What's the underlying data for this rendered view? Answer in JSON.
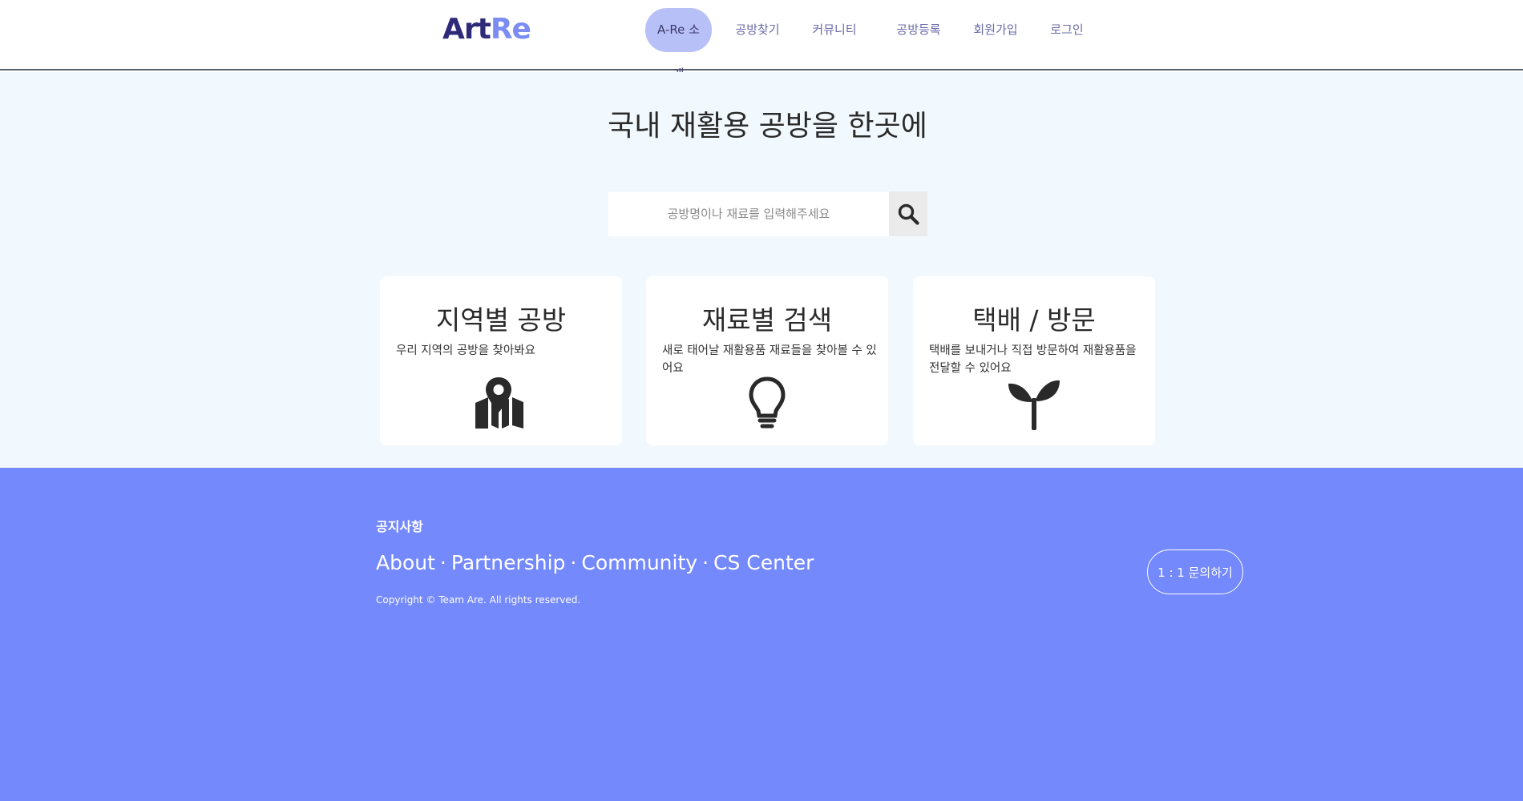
{
  "header": {
    "logo": {
      "part1": "Art",
      "part2": "Re"
    },
    "nav": [
      {
        "label": "A-Re 소개"
      },
      {
        "label": "공방찾기"
      },
      {
        "label": "커뮤니티"
      },
      {
        "label": "공방등록"
      },
      {
        "label": "회원가입"
      },
      {
        "label": "로그인"
      }
    ]
  },
  "hero": {
    "title": "국내 재활용 공방을 한곳에",
    "search": {
      "placeholder": "공방명이나 재료를 입력해주세요",
      "icon": "search-icon"
    },
    "cards": [
      {
        "title": "지역별 공방",
        "description": "우리 지역의 공방을 찾아봐요",
        "icon": "map-pin-icon"
      },
      {
        "title": "재료별 검색",
        "description": "새로 태어날 재활용품 재료들을 찾아볼 수 있어요",
        "icon": "lightbulb-icon"
      },
      {
        "title": "택배 / 방문",
        "description": "택배를 보내거나 직접 방문하여 재활용품을 전달할 수 있어요",
        "icon": "sprout-icon"
      }
    ]
  },
  "footer": {
    "notice": "공지사항",
    "links": [
      "About",
      "Partnership",
      "Community",
      "CS Center"
    ],
    "separator": "·",
    "copyright": "Copyright © Team Are. All rights reserved.",
    "inquiry_button": "1 : 1 문의하기"
  },
  "colors": {
    "logo_dark": "#2e2a78",
    "logo_accent": "#7b8cf2",
    "nav_active_bg": "#b8c0f8",
    "hero_bg": "#f1f9fe",
    "footer_bg": "#7489fb"
  }
}
